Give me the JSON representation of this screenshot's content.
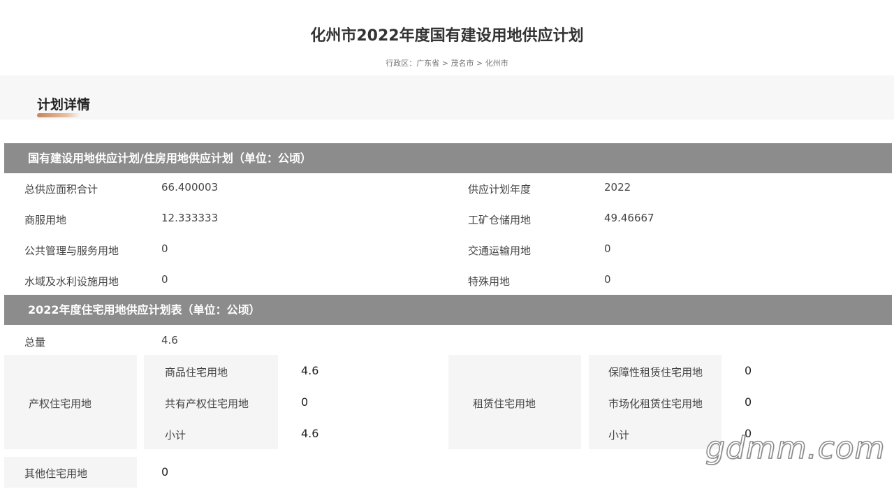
{
  "header": {
    "title": "化州市2022年度国有建设用地供应计划",
    "breadcrumb": "行政区：广东省 > 茂名市 > 化州市"
  },
  "detail": {
    "title": "计划详情"
  },
  "supply_plan": {
    "header": "国有建设用地供应计划/住房用地供应计划（单位：公顷）",
    "rows": [
      {
        "label_a": "总供应面积合计",
        "value_a": "66.400003",
        "label_b": "供应计划年度",
        "value_b": "2022"
      },
      {
        "label_a": "商服用地",
        "value_a": "12.333333",
        "label_b": "工矿仓储用地",
        "value_b": "49.46667"
      },
      {
        "label_a": "公共管理与服务用地",
        "value_a": "0",
        "label_b": "交通运输用地",
        "value_b": "0"
      },
      {
        "label_a": "水域及水利设施用地",
        "value_a": "0",
        "label_b": "特殊用地",
        "value_b": "0"
      }
    ]
  },
  "residential_plan": {
    "header": "2022年度住宅用地供应计划表（单位：公顷）",
    "total_label": "总量",
    "total_value": "4.6",
    "property": {
      "label": "产权住宅用地",
      "rows": [
        {
          "label": "商品住宅用地",
          "value": "4.6"
        },
        {
          "label": "共有产权住宅用地",
          "value": "0"
        },
        {
          "label": "小计",
          "value": "4.6"
        }
      ]
    },
    "rental": {
      "label": "租赁住宅用地",
      "rows": [
        {
          "label": "保障性租赁住宅用地",
          "value": "0"
        },
        {
          "label": "市场化租赁住宅用地",
          "value": "0"
        },
        {
          "label": "小计",
          "value": "0"
        }
      ]
    },
    "other_label": "其他住宅用地",
    "other_value": "0"
  },
  "watermark": "gdmm.com"
}
